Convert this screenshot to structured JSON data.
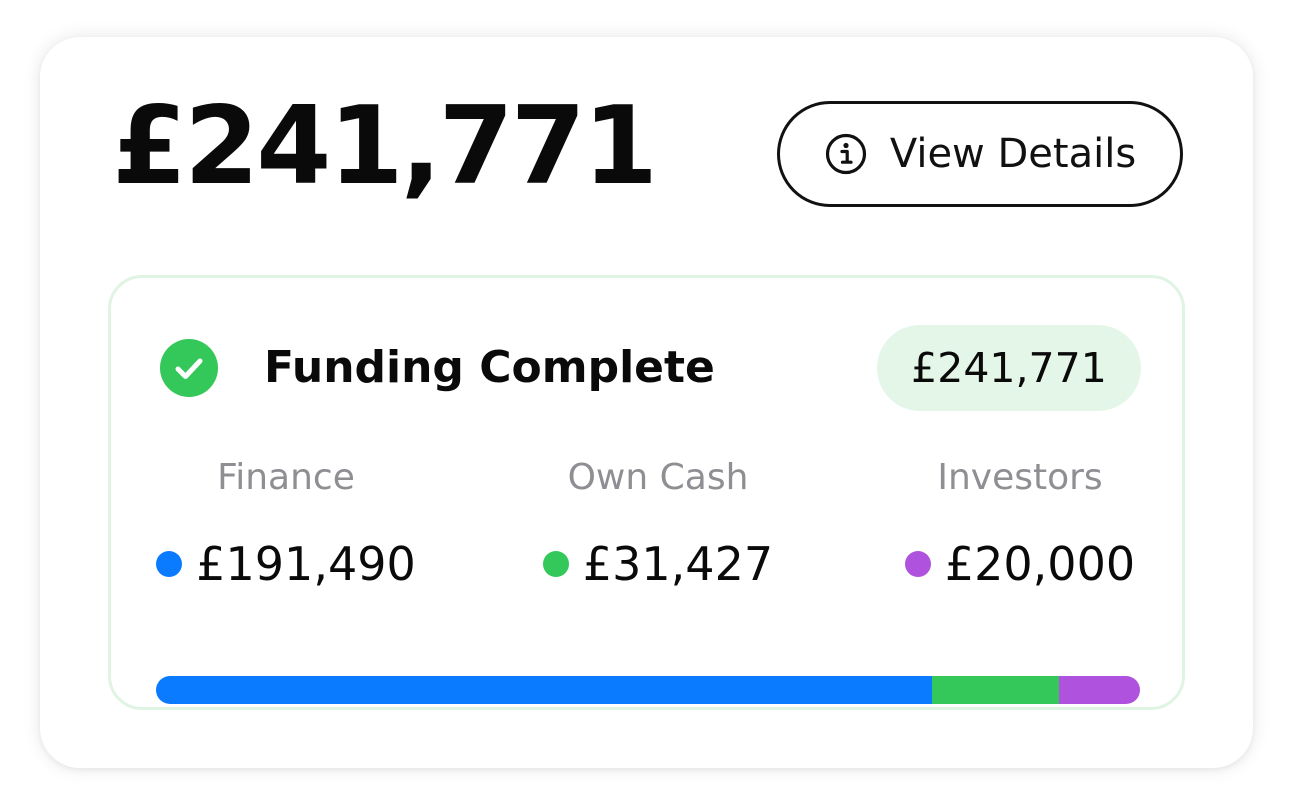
{
  "header": {
    "total_amount": "£241,771",
    "view_details_label": "View Details"
  },
  "icons": {
    "info": "info-circle-icon",
    "status": "check-circle-icon"
  },
  "funding": {
    "status_title": "Funding Complete",
    "status_amount": "£241,771",
    "sources": [
      {
        "label": "Finance",
        "amount": "£191,490",
        "value": 191490,
        "color": "#0a7aff"
      },
      {
        "label": "Own Cash",
        "amount": "£31,427",
        "value": 31427,
        "color": "#34c759"
      },
      {
        "label": "Investors",
        "amount": "£20,000",
        "value": 20000,
        "color": "#af52de"
      }
    ]
  },
  "colors": {
    "check_green": "#34c759",
    "pill_background": "#e3f6e7",
    "panel_border": "#dff4e3"
  }
}
